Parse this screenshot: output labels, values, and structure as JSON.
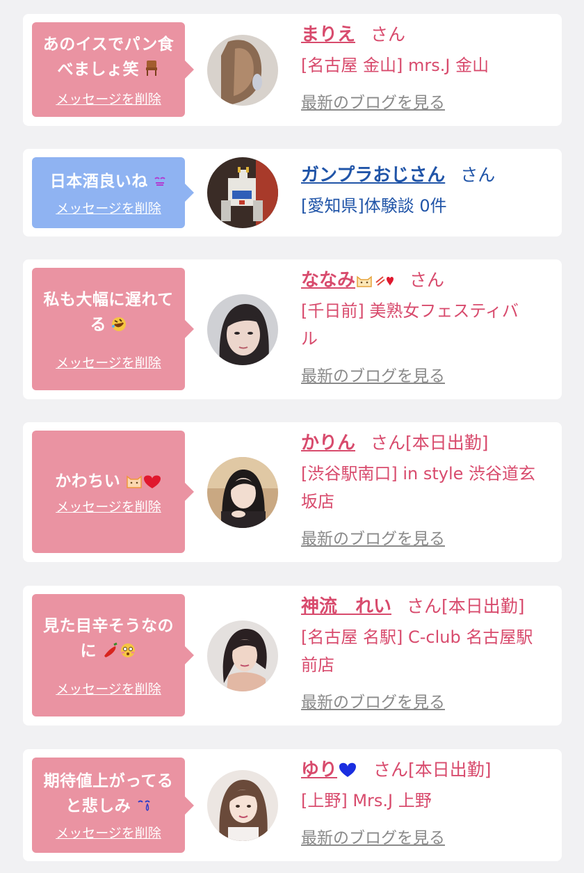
{
  "delete_label": "メッセージを削除",
  "blog_label": "最新のブログを見る",
  "colors": {
    "pink_text": "#d84b6d",
    "blue_text": "#2155a8",
    "pink_bubble": "#ea93a2",
    "blue_bubble": "#8fb3f2"
  },
  "cards": [
    {
      "message_lines": [
        "あのイスでパン食",
        "べましょ笑"
      ],
      "message_emoji": "chair",
      "name": "まりえ",
      "suffix": "さん",
      "shop_lines": [
        "[名古屋 金山] mrs.J 金山"
      ],
      "has_blog": true,
      "theme": "pink"
    },
    {
      "message_lines": [
        "日本酒良いね"
      ],
      "message_emoji": "sleepy-eyes",
      "name": "ガンプラおじさん",
      "suffix": "さん",
      "shop_lines": [
        "[愛知県]体験談 0件"
      ],
      "has_blog": false,
      "theme": "blue"
    },
    {
      "message_lines": [
        "私も大幅に遅れて",
        "る"
      ],
      "message_emoji": "rofl",
      "name": "ななみ",
      "suffix": "さん",
      "shop_lines": [
        "[千日前] 美熟女フェスティバ",
        "ル"
      ],
      "has_blog": true,
      "theme": "pink"
    },
    {
      "message_lines": [
        "かわちい"
      ],
      "message_emoji": "cat-heart",
      "name": "かりん",
      "suffix": "さん[本日出勤]",
      "shop_lines": [
        "[渋谷駅南口] in style 渋谷道玄",
        "坂店"
      ],
      "has_blog": true,
      "theme": "pink"
    },
    {
      "message_lines": [
        "見た目辛そうなの",
        "に"
      ],
      "message_emoji": "chili-flushed",
      "name": "神流　れい",
      "suffix": "さん[本日出勤]",
      "shop_lines": [
        "[名古屋 名駅] C-club 名古屋駅",
        "前店"
      ],
      "has_blog": true,
      "theme": "pink"
    },
    {
      "message_lines": [
        "期待値上がってる",
        "と悲しみ"
      ],
      "message_emoji": "sad-tear",
      "name": "ゆり",
      "suffix": "さん[本日出勤]",
      "shop_lines": [
        "[上野] Mrs.J 上野"
      ],
      "has_blog": true,
      "theme": "pink"
    }
  ]
}
